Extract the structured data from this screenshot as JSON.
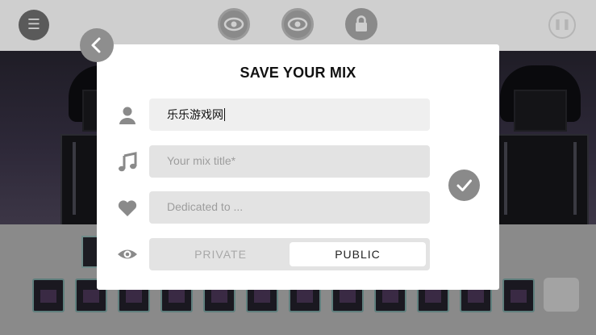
{
  "topbar": {
    "menu_icon": "menu-icon",
    "buttons": [
      {
        "icon": "eye-icon"
      },
      {
        "icon": "eye-icon"
      },
      {
        "icon": "lock-icon"
      }
    ],
    "pause_icon": "pause-icon"
  },
  "modal": {
    "title": "SAVE YOUR MIX",
    "name_field": {
      "value": "乐乐游戏网",
      "icon": "user-icon"
    },
    "title_field": {
      "placeholder": "Your mix title*",
      "icon": "music-note-icon"
    },
    "dedication_field": {
      "placeholder": "Dedicated to ...",
      "icon": "heart-icon"
    },
    "visibility": {
      "icon": "eye-icon",
      "options": [
        "PRIVATE",
        "PUBLIC"
      ],
      "selected": "PUBLIC"
    },
    "back_icon": "back-chevron-icon",
    "confirm_icon": "checkmark-icon"
  },
  "colors": {
    "modal_bg": "#ffffff",
    "field_bg": "#efefef",
    "field_bg_alt": "#e3e3e3",
    "icon_grey": "#8a8a8a",
    "title_text": "#111111",
    "placeholder_text": "#9d9d9d"
  }
}
